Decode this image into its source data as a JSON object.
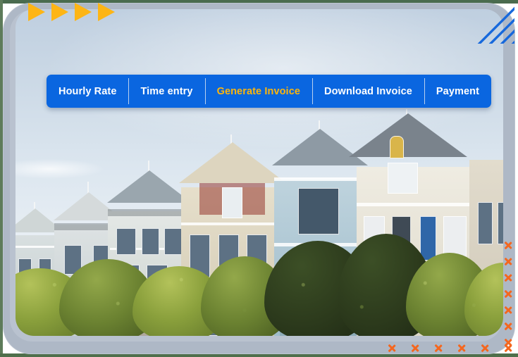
{
  "window": {
    "frame_color": "#aeb8c6",
    "frame_inner_color": "#b9c2cf"
  },
  "nav": {
    "background_color": "#0A66E0",
    "text_color": "#ffffff",
    "active_text_color": "#FFB60A",
    "divider_color": "#e1e8f0",
    "items": [
      {
        "label": "Hourly Rate",
        "active": false
      },
      {
        "label": "Time entry",
        "active": false
      },
      {
        "label": "Generate Invoice",
        "active": true
      },
      {
        "label": "Download Invoice",
        "active": false
      },
      {
        "label": "Payment",
        "active": false
      }
    ]
  },
  "decorations": {
    "triangles": {
      "icon": "play-triangle-icon",
      "color": "#FDB515",
      "count": 4
    },
    "striped_triangle": {
      "icon": "striped-triangle-icon",
      "color": "#1668DC",
      "stripe_count": 7
    },
    "x_marks": {
      "icon": "x-mark-icon",
      "color": "#F4671F",
      "column_count": 7,
      "row_count": 6
    }
  },
  "photo": {
    "alt": "Row of Victorian Painted Ladies houses with green hedges under a pale blue sky",
    "sky_color": "#c8d6e4",
    "hedge_color": "#6b8231"
  }
}
